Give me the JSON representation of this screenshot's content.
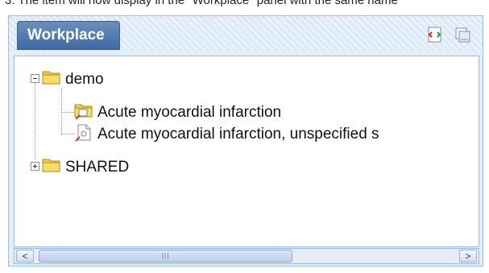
{
  "caption": "3. The item will now display in the \"Workplace\" panel with the same name",
  "panel": {
    "title": "Workplace",
    "tools": [
      "refresh-tree-icon",
      "collapse-panel-icon"
    ]
  },
  "tree": {
    "demo": {
      "label": "demo",
      "children": [
        {
          "label": "Acute myocardial infarction",
          "icon": "folder-item-icon"
        },
        {
          "label": "Acute myocardial infarction, unspecified s",
          "icon": "document-item-icon"
        }
      ]
    },
    "shared": {
      "label": "SHARED"
    }
  },
  "scrollbar": {
    "left_label": "<",
    "right_label": ">",
    "thumb_grip": "III"
  },
  "colors": {
    "tab_bg": "#4a74aa",
    "panel_border": "#99bbe8",
    "folder": "#f3cc3f"
  }
}
